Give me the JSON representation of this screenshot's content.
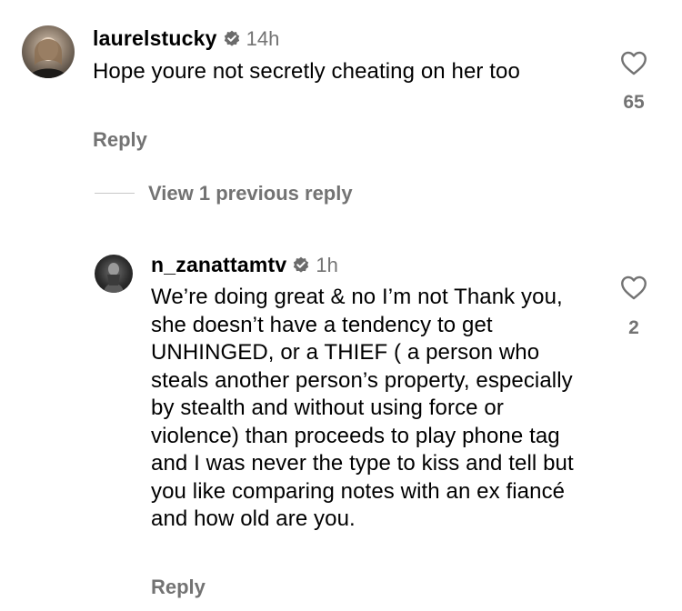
{
  "comments": [
    {
      "username": "laurelstucky",
      "verified": true,
      "time": "14h",
      "text": "Hope youre not secretly cheating on her too",
      "likes": "65",
      "reply_label": "Reply"
    },
    {
      "username": "n_zanattamtv",
      "verified": true,
      "time": "1h",
      "text": "We’re doing great & no I’m not Thank you, she doesn’t have a tendency to get UNHINGED, or a THIEF ( a person who steals another person’s property, especially by stealth and without using force or violence) than proceeds to play phone tag and I was never the type to kiss and tell but you like comparing notes with an ex fiancé and how old are you.",
      "likes": "2",
      "reply_label": "Reply"
    }
  ],
  "thread": {
    "view_previous": "View 1 previous reply"
  },
  "icons": {
    "verified": "verified-badge-icon",
    "like": "heart-outline-icon"
  },
  "colors": {
    "secondary_text": "#737373",
    "primary_text": "#000000"
  }
}
